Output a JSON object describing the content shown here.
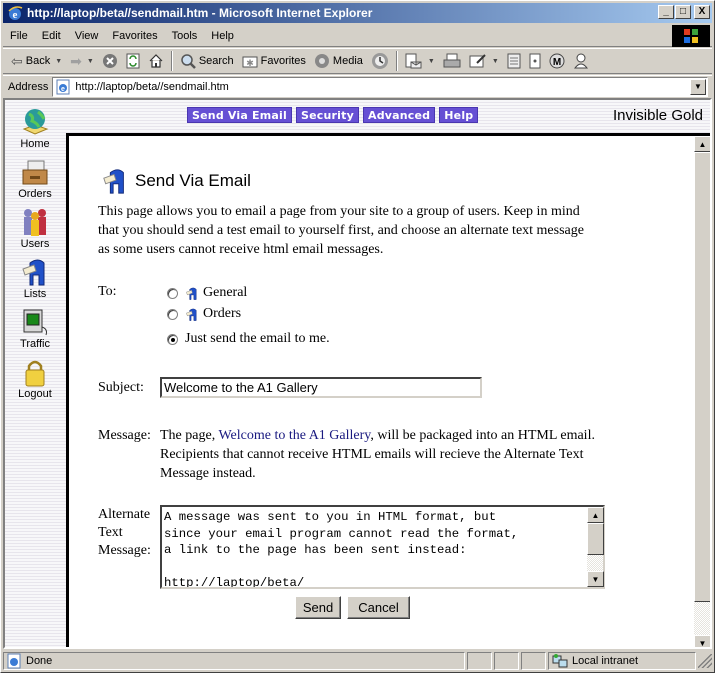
{
  "window": {
    "title": "http://laptop/beta//sendmail.htm - Microsoft Internet Explorer",
    "controls": {
      "minimize": "_",
      "maximize": "□",
      "close": "X"
    }
  },
  "menubar": {
    "items": [
      {
        "label": "File",
        "accel": "F"
      },
      {
        "label": "Edit",
        "accel": "E"
      },
      {
        "label": "View",
        "accel": "V"
      },
      {
        "label": "Favorites",
        "accel": "a"
      },
      {
        "label": "Tools",
        "accel": "T"
      },
      {
        "label": "Help",
        "accel": "H"
      }
    ]
  },
  "toolbar": {
    "back_label": "Back",
    "search_label": "Search",
    "favorites_label": "Favorites",
    "media_label": "Media"
  },
  "addressbar": {
    "label": "Address",
    "value": "http://laptop/beta//sendmail.htm"
  },
  "site": {
    "brand": "Invisible Gold",
    "tab_color": "#6650d4",
    "nav_tabs": [
      {
        "label": "Send Via Email"
      },
      {
        "label": "Security"
      },
      {
        "label": "Advanced"
      },
      {
        "label": "Help"
      }
    ],
    "sidebar": [
      {
        "label": "Home",
        "icon": "globe-icon"
      },
      {
        "label": "Orders",
        "icon": "box-icon"
      },
      {
        "label": "Users",
        "icon": "users-icon"
      },
      {
        "label": "Lists",
        "icon": "mailbox-icon"
      },
      {
        "label": "Traffic",
        "icon": "monitor-icon"
      },
      {
        "label": "Logout",
        "icon": "padlock-icon"
      }
    ]
  },
  "page": {
    "title": "Send Via Email",
    "intro": "This page allows you to email a page from your site to a group of users. Keep in mind that you should send a test email to yourself first, and choose an alternate text message as some users cannot receive html email messages.",
    "to_label": "To:",
    "recipients": [
      {
        "label": "General",
        "selected": false,
        "has_icon": true
      },
      {
        "label": "Orders",
        "selected": false,
        "has_icon": true
      },
      {
        "label": "Just send the email to me.",
        "selected": true,
        "has_icon": false
      }
    ],
    "subject_label": "Subject:",
    "subject_value": "Welcome to the A1 Gallery",
    "message_label": "Message:",
    "message_prefix": "The page, ",
    "message_link": "Welcome to the A1 Gallery",
    "message_suffix": ", will be packaged into an HTML email. Recipients that cannot receive HTML emails will recieve the Alternate Text Message instead.",
    "alt_label_1": "Alternate",
    "alt_label_2": "Text",
    "alt_label_3": "Message:",
    "alt_text": "A message was sent to you in HTML format, but\nsince your email program cannot read the format,\na link to the page has been sent instead:\n\nhttp://laptop/beta/",
    "send_label": "Send",
    "cancel_label": "Cancel"
  },
  "statusbar": {
    "status": "Done",
    "zone": "Local intranet"
  }
}
